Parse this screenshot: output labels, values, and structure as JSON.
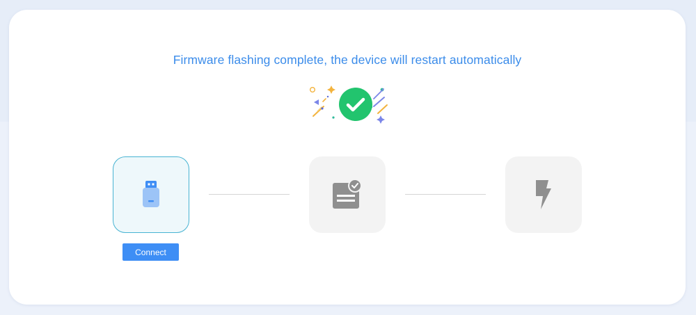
{
  "title": "Firmware flashing complete, the device will restart automatically",
  "steps": [
    {
      "id": "connect",
      "icon": "usb-drive-icon",
      "active": true
    },
    {
      "id": "flash",
      "icon": "document-check-icon",
      "active": false
    },
    {
      "id": "restart",
      "icon": "lightning-icon",
      "active": false
    }
  ],
  "connect_button": {
    "label": "Connect"
  },
  "colors": {
    "accent": "#3e8ef5",
    "title": "#3b8cea",
    "success": "#22c46e",
    "active_step_border": "#47b3d2",
    "inactive_icon": "#8f8f8f"
  }
}
